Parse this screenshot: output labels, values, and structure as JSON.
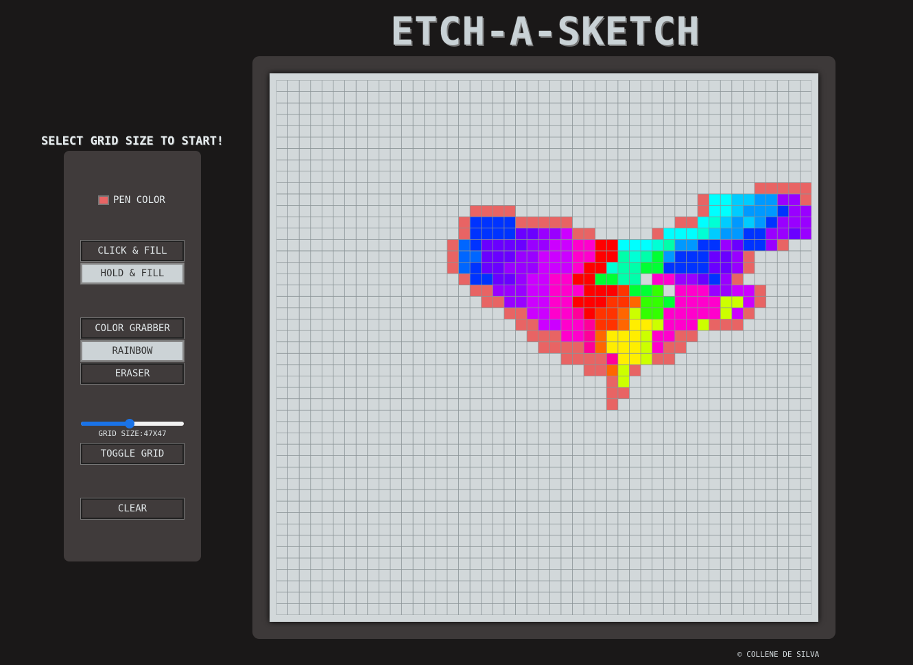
{
  "title": "ETCH-A-SKETCH",
  "prompt": "SELECT GRID SIZE TO START!",
  "controls": {
    "pen_color_label": "PEN COLOR",
    "pen_color": "#e86464",
    "click_fill": "CLICK & FILL",
    "hold_fill": "HOLD & FILL",
    "color_grabber": "COLOR GRABBER",
    "rainbow": "RAINBOW",
    "eraser": "ERASER",
    "grid_size_label": "GRID SIZE:47X47",
    "grid_size_value": 47,
    "grid_size_fraction": 0.47,
    "toggle_grid": "TOGGLE GRID",
    "clear": "CLEAR"
  },
  "board": {
    "cols": 47,
    "rows": 47,
    "background": "#d2d8da",
    "gridline_color": "#8a9396",
    "palette": {
      "P": "#e86464",
      "B": "#0033ff",
      "b": "#0066ff",
      "V": "#6a00ff",
      "v": "#9900ff",
      "M": "#cc00ff",
      "K": "#ff00cc",
      "k": "#ff0099",
      "R": "#ff0000",
      "r": "#ff3300",
      "O": "#ff6600",
      "o": "#ff9900",
      "Y": "#ffee00",
      "y": "#ccff00",
      "G": "#33ff00",
      "g": "#00ff33",
      "T": "#00ffaa",
      "t": "#00ffd5",
      "C": "#00ffff",
      "c": "#00ccff",
      "S": "#0099ff"
    },
    "pixels": [
      "...........................................",
      "...........................................",
      "...........................................",
      "...........................................",
      "...........................................",
      "...........................................",
      "...........................................",
      "...........................................",
      "...........................................",
      "...................................PPPPPPP",
      "..............................PCCccSSvvPP",
      "..........PPPP................PCCcSSSBvvvP",
      ".........PBBBBPPPPP.........PPCtcScSBvvvMP",
      ".........PBBBBVVvvMPP.....PCCCtcSSBBvvVvP",
      "........PbBVVVVvvMMKKRRCCCtTSSBBvVBBvP",
      "........PbbVVVvvMMMKKRRTtTgSBBBVVvP",
      "........PbBVVvvvMMMKRRtTTggBBBBVVvP",
      ".........PBBVVvMMKKRRggTT.KKvvVBvP",
      "..........PPvvvMMKKKRRRrggG.KKKvvMMP",
      "...........PPvvMMKKRRRrrOGGgKKKKyyMP",
      ".............PPMMKKkRrrOyGGKKKKKyMP",
      "..............PPMMKKkrrOYYyKKKyPPP",
      "...............PPPKKkOYYYyKKPP",
      "................PPPPkOYYYyKPP",
      "..................PPPPkYYyPP",
      "....................PPOyP",
      "......................Py",
      "......................PP",
      "......................P"
    ]
  }
}
